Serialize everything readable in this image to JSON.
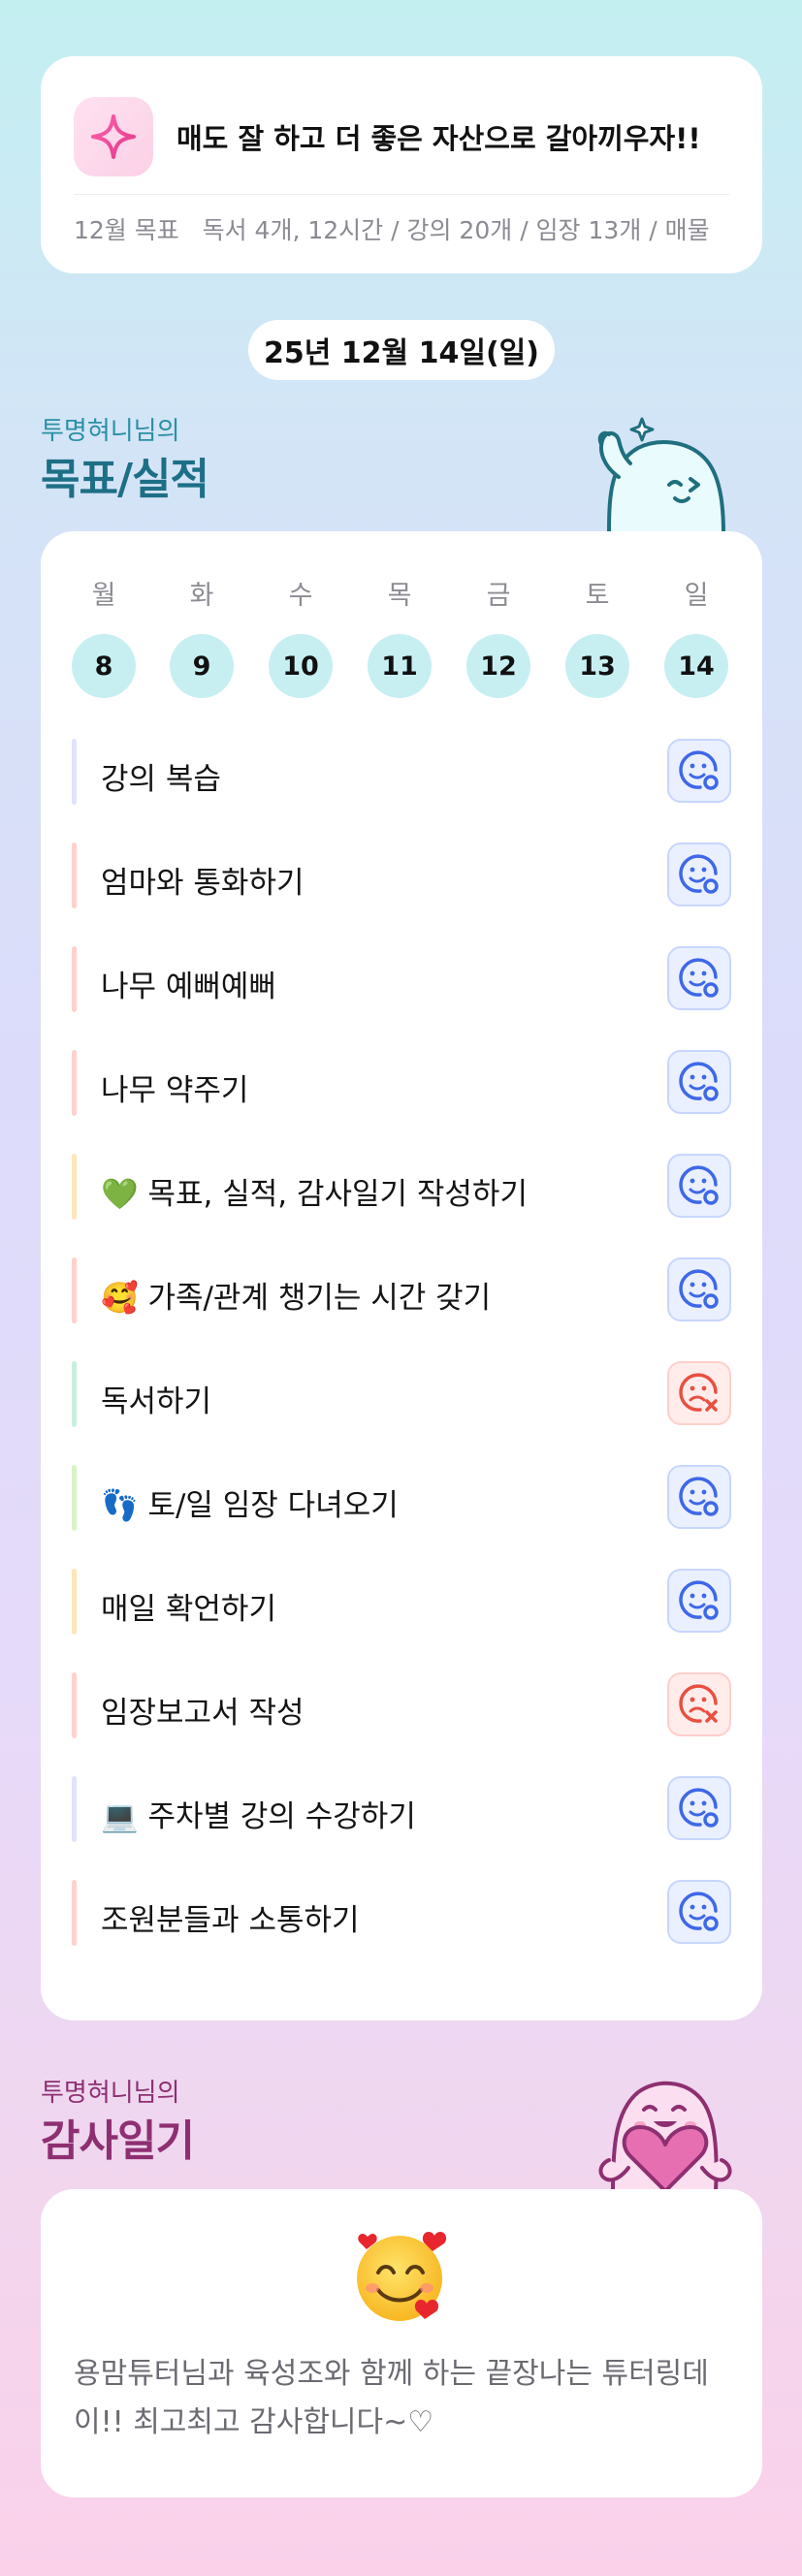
{
  "goal": {
    "headline": "매도 잘 하고 더 좋은 자산으로 갈아끼우자!!",
    "label": "12월 목표",
    "detail": "독서 4개, 12시간 / 강의 20개 / 임장 13개 / 매물"
  },
  "date": "25년 12월 14일(일)",
  "performance": {
    "owner": "투명혀니님의",
    "title": "목표/실적"
  },
  "week": {
    "weekdays": [
      "월",
      "화",
      "수",
      "목",
      "금",
      "토",
      "일"
    ],
    "days": [
      "8",
      "9",
      "10",
      "11",
      "12",
      "13",
      "14"
    ]
  },
  "tasks": [
    {
      "label": "강의 복습",
      "status": "done",
      "bar": "#dfe3fb"
    },
    {
      "label": "엄마와 통화하기",
      "status": "done",
      "bar": "#ffd1cc"
    },
    {
      "label": "나무 예뻐예뻐",
      "status": "done",
      "bar": "#ffd1cc"
    },
    {
      "label": "나무 약주기",
      "status": "done",
      "bar": "#ffd1cc"
    },
    {
      "label": "💚 목표, 실적, 감사일기 작성하기",
      "status": "done",
      "bar": "#ffe6b8"
    },
    {
      "label": "🥰 가족/관계 챙기는 시간 갖기",
      "status": "done",
      "bar": "#ffd1cc"
    },
    {
      "label": "독서하기",
      "status": "missed",
      "bar": "#c9f0de"
    },
    {
      "label": "👣 토/일 임장 다녀오기",
      "status": "done",
      "bar": "#d8f3c5"
    },
    {
      "label": "매일 확언하기",
      "status": "done",
      "bar": "#ffe6b8"
    },
    {
      "label": "임장보고서 작성",
      "status": "missed",
      "bar": "#ffd1cc"
    },
    {
      "label": "💻 주차별 강의 수강하기",
      "status": "done",
      "bar": "#dfe3fb"
    },
    {
      "label": "조원분들과 소통하기",
      "status": "done",
      "bar": "#ffd1cc"
    }
  ],
  "gratitude": {
    "owner": "투명혀니님의",
    "title": "감사일기",
    "emoji": "smiling-face-with-hearts-icon",
    "text": "용맘튜터님과 육성조와 함께 하는 끝장나는 튜터링데이!! 최고최고 감사합니다~♡"
  },
  "colors": {
    "accent_teal": "#1d6f86",
    "accent_plum": "#8e2f72",
    "done_icon": "#3e68e8",
    "missed_icon": "#e8503f",
    "day_circle": "#c7eff2"
  }
}
